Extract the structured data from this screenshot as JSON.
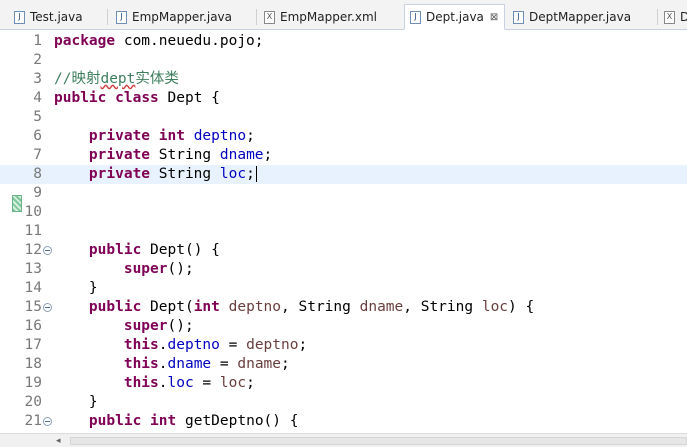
{
  "tabs": [
    {
      "label": "Test.java",
      "icon": "java-file-icon",
      "active": false
    },
    {
      "label": "EmpMapper.java",
      "icon": "java-file-icon",
      "active": false
    },
    {
      "label": "EmpMapper.xml",
      "icon": "xml-file-icon",
      "active": false
    },
    {
      "label": "Dept.java",
      "icon": "java-file-icon",
      "active": true
    },
    {
      "label": "DeptMapper.java",
      "icon": "java-file-icon",
      "active": false
    },
    {
      "label": "D",
      "icon": "xml-file-icon",
      "active": false
    }
  ],
  "icon_glyphs": {
    "java": "J",
    "xml": "X",
    "close": "⊠"
  },
  "current_line": 8,
  "lines": [
    {
      "n": "1",
      "tokens": [
        [
          "kw",
          "package"
        ],
        [
          "",
          " com.neuedu.pojo;"
        ]
      ]
    },
    {
      "n": "2",
      "tokens": []
    },
    {
      "n": "3",
      "tokens": [
        [
          "cmt",
          "//映射"
        ],
        [
          "cmt-spell",
          "dept"
        ],
        [
          "cmt",
          "实体类"
        ]
      ]
    },
    {
      "n": "4",
      "tokens": [
        [
          "kw",
          "public"
        ],
        [
          "",
          " "
        ],
        [
          "kw",
          "class"
        ],
        [
          "",
          " Dept {"
        ]
      ]
    },
    {
      "n": "5",
      "tokens": []
    },
    {
      "n": "6",
      "tokens": [
        [
          "",
          "    "
        ],
        [
          "kw",
          "private"
        ],
        [
          "",
          " "
        ],
        [
          "kw",
          "int"
        ],
        [
          "",
          " "
        ],
        [
          "fld",
          "deptno"
        ],
        [
          "",
          ";"
        ]
      ]
    },
    {
      "n": "7",
      "tokens": [
        [
          "",
          "    "
        ],
        [
          "kw",
          "private"
        ],
        [
          "",
          " String "
        ],
        [
          "fld",
          "dname"
        ],
        [
          "",
          ";"
        ]
      ]
    },
    {
      "n": "8",
      "tokens": [
        [
          "",
          "    "
        ],
        [
          "kw",
          "private"
        ],
        [
          "",
          " String "
        ],
        [
          "fld",
          "loc"
        ],
        [
          "",
          ";"
        ]
      ]
    },
    {
      "n": "9",
      "tokens": []
    },
    {
      "n": "10",
      "tokens": []
    },
    {
      "n": "11",
      "tokens": []
    },
    {
      "n": "12",
      "fold": true,
      "tokens": [
        [
          "",
          "    "
        ],
        [
          "kw",
          "public"
        ],
        [
          "",
          " Dept() {"
        ]
      ]
    },
    {
      "n": "13",
      "tokens": [
        [
          "",
          "        "
        ],
        [
          "kw",
          "super"
        ],
        [
          "",
          "();"
        ]
      ]
    },
    {
      "n": "14",
      "tokens": [
        [
          "",
          "    }"
        ]
      ]
    },
    {
      "n": "15",
      "fold": true,
      "tokens": [
        [
          "",
          "    "
        ],
        [
          "kw",
          "public"
        ],
        [
          "",
          " Dept("
        ],
        [
          "kw",
          "int"
        ],
        [
          "",
          " "
        ],
        [
          "param",
          "deptno"
        ],
        [
          "",
          ", String "
        ],
        [
          "param",
          "dname"
        ],
        [
          "",
          ", String "
        ],
        [
          "param",
          "loc"
        ],
        [
          "",
          ") {"
        ]
      ]
    },
    {
      "n": "16",
      "tokens": [
        [
          "",
          "        "
        ],
        [
          "kw",
          "super"
        ],
        [
          "",
          "();"
        ]
      ]
    },
    {
      "n": "17",
      "tokens": [
        [
          "",
          "        "
        ],
        [
          "kw",
          "this"
        ],
        [
          "",
          "."
        ],
        [
          "fld",
          "deptno"
        ],
        [
          "",
          " = "
        ],
        [
          "param",
          "deptno"
        ],
        [
          "",
          ";"
        ]
      ]
    },
    {
      "n": "18",
      "tokens": [
        [
          "",
          "        "
        ],
        [
          "kw",
          "this"
        ],
        [
          "",
          "."
        ],
        [
          "fld",
          "dname"
        ],
        [
          "",
          " = "
        ],
        [
          "param",
          "dname"
        ],
        [
          "",
          ";"
        ]
      ]
    },
    {
      "n": "19",
      "tokens": [
        [
          "",
          "        "
        ],
        [
          "kw",
          "this"
        ],
        [
          "",
          "."
        ],
        [
          "fld",
          "loc"
        ],
        [
          "",
          " = "
        ],
        [
          "param",
          "loc"
        ],
        [
          "",
          ";"
        ]
      ]
    },
    {
      "n": "20",
      "tokens": [
        [
          "",
          "    }"
        ]
      ]
    },
    {
      "n": "21",
      "fold": true,
      "tokens": [
        [
          "",
          "    "
        ],
        [
          "kw",
          "public"
        ],
        [
          "",
          " "
        ],
        [
          "kw",
          "int"
        ],
        [
          "",
          " getDeptno() {"
        ]
      ]
    }
  ],
  "scrollbar": {
    "left_arrow": "◂"
  }
}
